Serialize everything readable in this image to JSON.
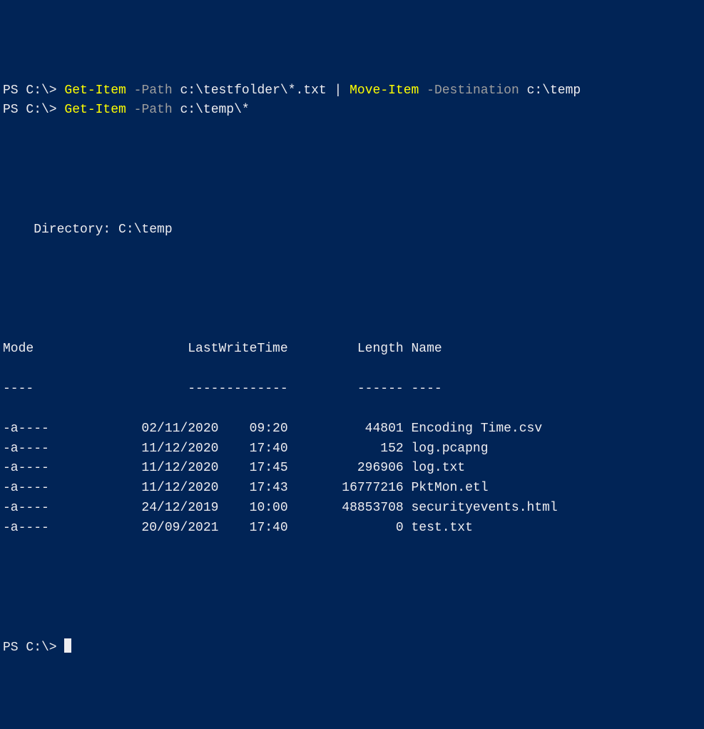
{
  "prompt": "PS C:\\> ",
  "commands": {
    "line1": {
      "cmd1": "Get-Item",
      "param1": "-Path",
      "arg1": "c:\\testfolder\\*.txt",
      "pipe": " | ",
      "cmd2": "Move-Item",
      "param2": "-Destination",
      "arg2": "c:\\temp"
    },
    "line2": {
      "cmd1": "Get-Item",
      "param1": "-Path",
      "arg1": "c:\\temp\\*"
    }
  },
  "directory_label": "    Directory: C:\\temp",
  "headers": {
    "mode": "Mode",
    "lwt": "LastWriteTime",
    "length": "Length",
    "name": "Name"
  },
  "dashes": {
    "mode": "----",
    "lwt": "-------------",
    "length": "------",
    "name": "----"
  },
  "files": [
    {
      "mode": "-a----",
      "date": "02/11/2020",
      "time": "09:20",
      "length": "44801",
      "name": "Encoding Time.csv"
    },
    {
      "mode": "-a----",
      "date": "11/12/2020",
      "time": "17:40",
      "length": "152",
      "name": "log.pcapng"
    },
    {
      "mode": "-a----",
      "date": "11/12/2020",
      "time": "17:45",
      "length": "296906",
      "name": "log.txt"
    },
    {
      "mode": "-a----",
      "date": "11/12/2020",
      "time": "17:43",
      "length": "16777216",
      "name": "PktMon.etl"
    },
    {
      "mode": "-a----",
      "date": "24/12/2019",
      "time": "10:00",
      "length": "48853708",
      "name": "securityevents.html"
    },
    {
      "mode": "-a----",
      "date": "20/09/2021",
      "time": "17:40",
      "length": "0",
      "name": "test.txt"
    }
  ]
}
